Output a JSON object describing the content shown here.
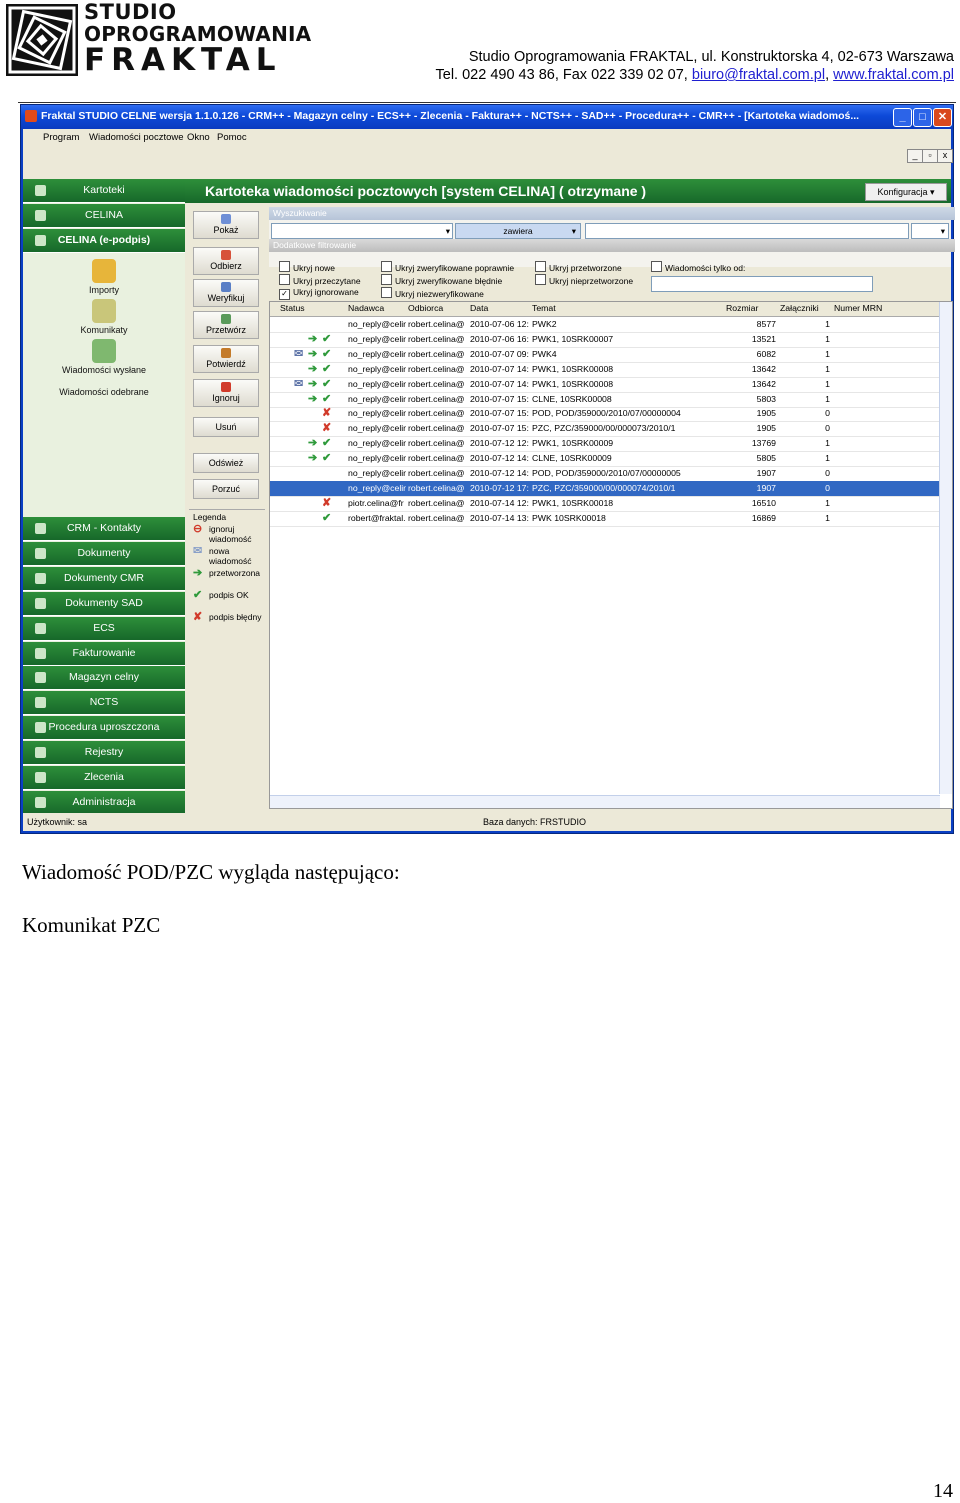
{
  "letterhead": {
    "brand_line1": "STUDIO",
    "brand_line2": "OPROGRAMOWANIA",
    "brand_line3": "FRAKTAL",
    "address": "Studio Oprogramowania FRAKTAL, ul. Konstruktorska 4, 02-673 Warszawa",
    "contact_prefix": "Tel. 022 490 43 86, Fax 022 339 02 07, ",
    "email": "biuro@fraktal.com.pl",
    "separator": ", ",
    "website": "www.fraktal.com.pl"
  },
  "app": {
    "window_title": "Fraktal STUDIO CELNE  wersja 1.1.0.126 - CRM++ - Magazyn celny - ECS++ - Zlecenia - Faktura++ - NCTS++ - SAD++ - Procedura++ - CMR++ - [Kartoteka wiadomoś...",
    "menu": [
      "Program",
      "Wiadomości pocztowe",
      "Okno",
      "Pomoc"
    ],
    "nav_top": [
      {
        "label": "Kartoteki",
        "icon": "folder-icon"
      },
      {
        "label": "CELINA",
        "icon": "celina-icon"
      },
      {
        "label": "CELINA (e-podpis)",
        "icon": "signature-icon"
      }
    ],
    "nav_sub": [
      {
        "label": "Importy",
        "icon": "import-icon"
      },
      {
        "label": "Komunikaty",
        "icon": "message-icon"
      },
      {
        "label": "Wiadomości wysłane",
        "icon": "sent-icon"
      },
      {
        "label": "Wiadomości odebrane",
        "icon": "received-icon"
      }
    ],
    "nav_bottom": [
      "CRM - Kontakty",
      "Dokumenty",
      "Dokumenty CMR",
      "Dokumenty SAD",
      "ECS",
      "Fakturowanie",
      "Magazyn celny",
      "NCTS",
      "Procedura uproszczona",
      "Rejestry",
      "Zlecenia",
      "Administracja"
    ],
    "panel_title": "Kartoteka wiadomości pocztowych [system CELINA] ( otrzymane )",
    "konfiguracja_label": "Konfiguracja",
    "actions": [
      "Pokaż",
      "Odbierz",
      "Weryfikuj",
      "Przetwórz",
      "Potwierdź",
      "Ignoruj",
      "Usuń",
      "Odśwież",
      "Porzuć"
    ],
    "search_label": "Wyszukiwanie",
    "search_operator": "zawiera",
    "extra_filter_label": "Dodatkowe filtrowanie",
    "filters": [
      "Ukryj nowe",
      "Ukryj przeczytane",
      "Ukryj ignorowane",
      "Ukryj zweryfikowane poprawnie",
      "Ukryj zweryfikowane błędnie",
      "Ukryj niezweryfikowane",
      "Ukryj przetworzone",
      "Ukryj nieprzetworzone",
      "Wiadomości tylko od:"
    ],
    "legend_title": "Legenda",
    "legend": [
      {
        "label": "ignoruj wiadomość",
        "icon": "ignore-icon"
      },
      {
        "label": "nowa wiadomość",
        "icon": "envelope-icon"
      },
      {
        "label": "przetworzona",
        "icon": "processed-arrow-icon"
      },
      {
        "label": "podpis OK",
        "icon": "check-icon"
      },
      {
        "label": "podpis błędny",
        "icon": "cross-icon"
      }
    ],
    "columns": [
      "Status",
      "Nadawca",
      "Odbiorca",
      "Data",
      "Temat",
      "Rozmiar",
      "Załączniki",
      "Numer MRN"
    ],
    "rows": [
      {
        "status": [],
        "from": "no_reply@celin",
        "to": "robert.celina@",
        "date": "2010-07-06 12:",
        "subject": "PWK2",
        "size": "8577",
        "att": "1"
      },
      {
        "status": [
          "arrow",
          "check"
        ],
        "from": "no_reply@celin",
        "to": "robert.celina@",
        "date": "2010-07-06 16:",
        "subject": "PWK1, 10SRK00007",
        "size": "13521",
        "att": "1"
      },
      {
        "status": [
          "mail",
          "arrow",
          "check"
        ],
        "from": "no_reply@celin",
        "to": "robert.celina@",
        "date": "2010-07-07 09:",
        "subject": "PWK4",
        "size": "6082",
        "att": "1"
      },
      {
        "status": [
          "arrow",
          "check"
        ],
        "from": "no_reply@celin",
        "to": "robert.celina@",
        "date": "2010-07-07 14:",
        "subject": "PWK1, 10SRK00008",
        "size": "13642",
        "att": "1"
      },
      {
        "status": [
          "mail",
          "arrow",
          "check"
        ],
        "from": "no_reply@celin",
        "to": "robert.celina@",
        "date": "2010-07-07 14:",
        "subject": "PWK1, 10SRK00008",
        "size": "13642",
        "att": "1"
      },
      {
        "status": [
          "arrow",
          "check"
        ],
        "from": "no_reply@celin",
        "to": "robert.celina@",
        "date": "2010-07-07 15:",
        "subject": "CLNE, 10SRK00008",
        "size": "5803",
        "att": "1"
      },
      {
        "status": [
          "cross"
        ],
        "from": "no_reply@celin",
        "to": "robert.celina@",
        "date": "2010-07-07 15:",
        "subject": "POD, POD/359000/2010/07/00000004",
        "size": "1905",
        "att": "0"
      },
      {
        "status": [
          "cross"
        ],
        "from": "no_reply@celin",
        "to": "robert.celina@",
        "date": "2010-07-07 15:",
        "subject": "PZC, PZC/359000/00/000073/2010/1",
        "size": "1905",
        "att": "0"
      },
      {
        "status": [
          "arrow",
          "check"
        ],
        "from": "no_reply@celin",
        "to": "robert.celina@",
        "date": "2010-07-12 12:",
        "subject": "PWK1, 10SRK00009",
        "size": "13769",
        "att": "1"
      },
      {
        "status": [
          "arrow",
          "check"
        ],
        "from": "no_reply@celin",
        "to": "robert.celina@",
        "date": "2010-07-12 14:",
        "subject": "CLNE, 10SRK00009",
        "size": "5805",
        "att": "1"
      },
      {
        "status": [],
        "from": "no_reply@celin",
        "to": "robert.celina@",
        "date": "2010-07-12 14:",
        "subject": "POD, POD/359000/2010/07/00000005",
        "size": "1907",
        "att": "0"
      },
      {
        "status": [],
        "from": "no_reply@celin",
        "to": "robert.celina@",
        "date": "2010-07-12 17:",
        "subject": "PZC, PZC/359000/00/000074/2010/1",
        "size": "1907",
        "att": "0",
        "selected": true
      },
      {
        "status": [
          "cross"
        ],
        "from": "piotr.celina@fr",
        "to": "robert.celina@",
        "date": "2010-07-14 12:",
        "subject": "PWK1, 10SRK00018",
        "size": "16510",
        "att": "1"
      },
      {
        "status": [
          "check"
        ],
        "from": "robert@fraktal.",
        "to": "robert.celina@",
        "date": "2010-07-14 13:",
        "subject": "PWK 10SRK00018",
        "size": "16869",
        "att": "1"
      }
    ],
    "status_user": "Użytkownik: sa",
    "status_db": "Baza danych: FRSTUDIO"
  },
  "document": {
    "line1": "Wiadomość POD/PZC wygląda następująco:",
    "line2": "Komunikat PZC",
    "page_number": "14"
  },
  "colors": {
    "nav_green": "#17682a",
    "title_blue": "#0d49d8",
    "selected_row": "#3168c3",
    "link": "#1f1fd0"
  }
}
